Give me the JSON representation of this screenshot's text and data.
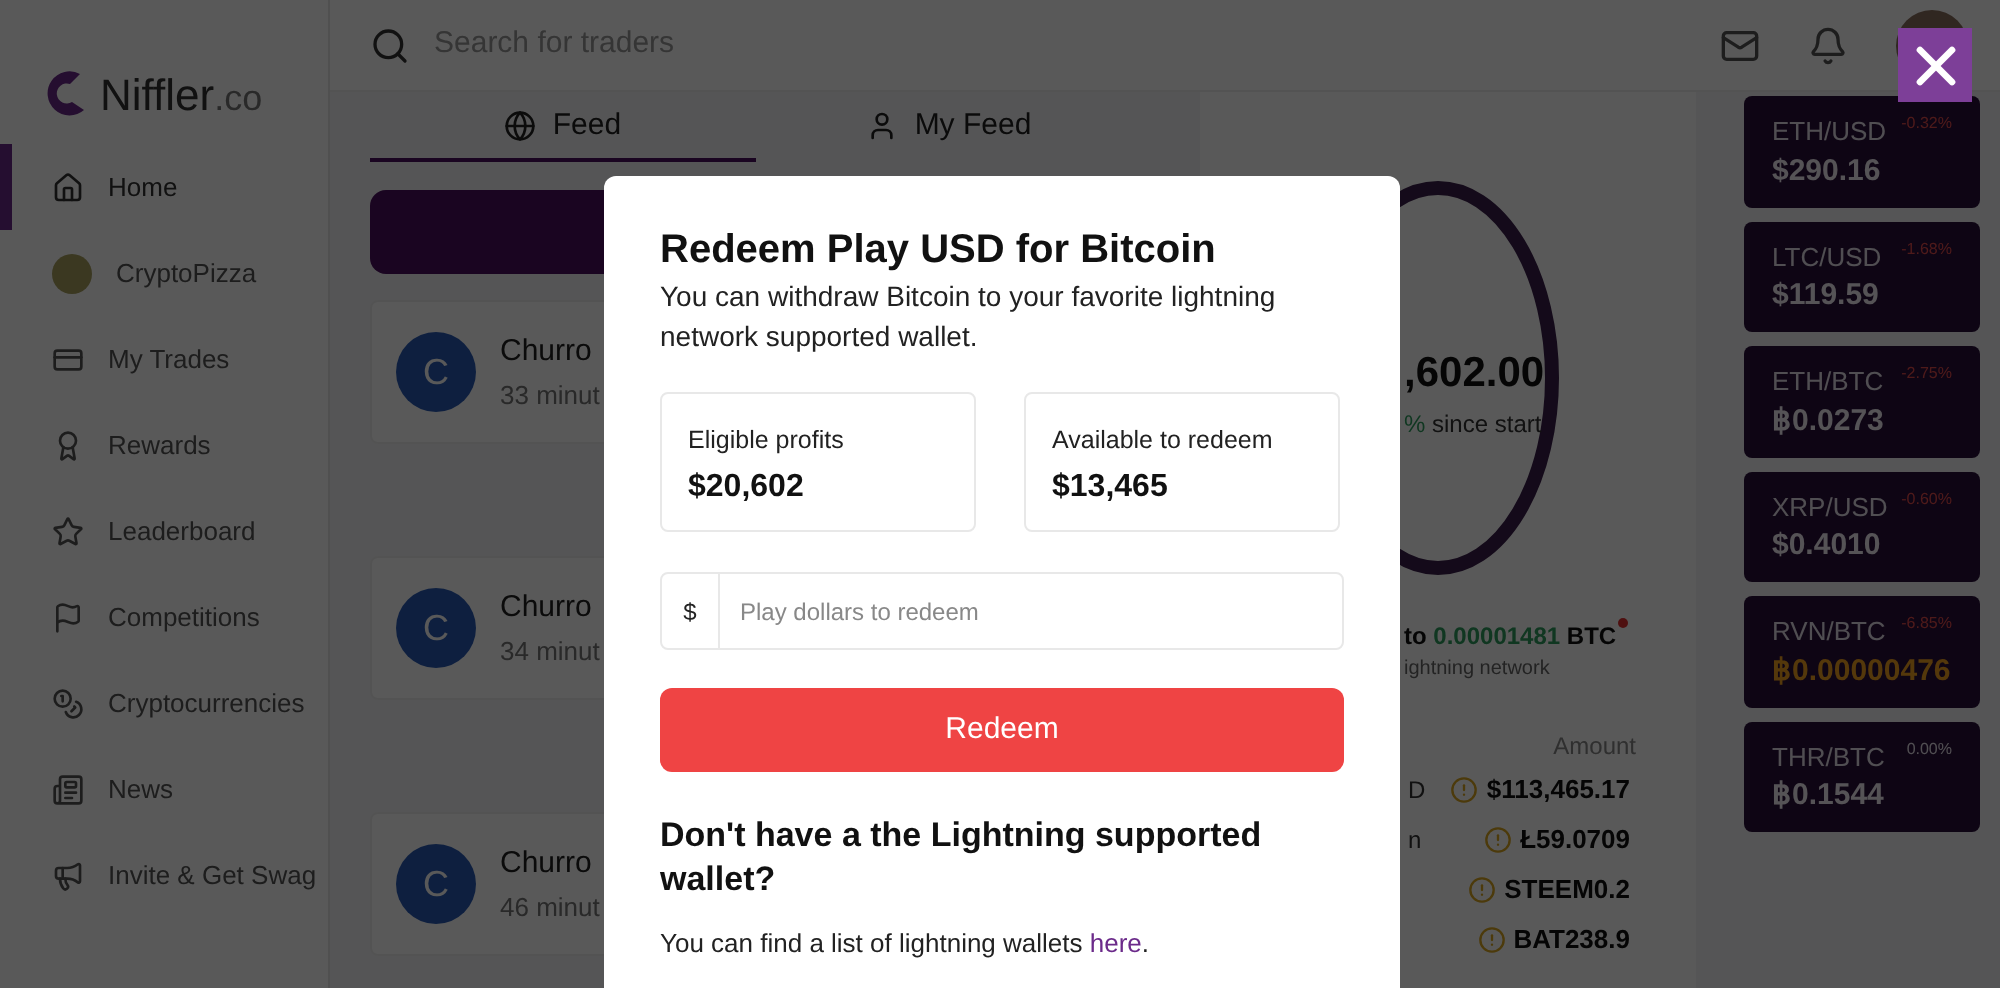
{
  "sidebar": {
    "logo": {
      "name": "Niffler",
      "suffix": ".co"
    },
    "items": [
      {
        "label": "Home",
        "selected": true
      },
      {
        "label": "CryptoPizza",
        "selected": false
      },
      {
        "label": "My Trades",
        "selected": false
      },
      {
        "label": "Rewards",
        "selected": false
      },
      {
        "label": "Leaderboard",
        "selected": false
      },
      {
        "label": "Competitions",
        "selected": false
      },
      {
        "label": "Cryptocurrencies",
        "selected": false
      },
      {
        "label": "News",
        "selected": false
      },
      {
        "label": "Invite & Get Swag",
        "selected": false
      }
    ]
  },
  "header": {
    "search": {
      "placeholder": "Search for traders"
    }
  },
  "feed": {
    "tabs": [
      {
        "label": "Feed",
        "selected": true
      },
      {
        "label": "My Feed",
        "selected": false
      }
    ],
    "posts": [
      {
        "initial": "C",
        "name": "Churro",
        "time": "33 minut"
      },
      {
        "initial": "C",
        "name": "Churro",
        "time": "34 minut"
      },
      {
        "initial": "C",
        "name": "Churro",
        "time": "46 minut"
      }
    ]
  },
  "portfolio": {
    "total": ",602.00",
    "change": "%",
    "change_label": "since start",
    "withdraw_prefix": "to",
    "withdraw_amount": "0.00001481",
    "withdraw_unit": "BTC",
    "withdraw_note": "ightning network",
    "amount_header": "Amount",
    "holdings": [
      {
        "label": "D",
        "amount": "$113,465.17"
      },
      {
        "label": "n",
        "amount": "Ł59.0709"
      },
      {
        "amount": "STEEM0.2"
      },
      {
        "amount": "BAT238.9"
      }
    ]
  },
  "tickers": [
    {
      "kind": "loss",
      "pair": "ETH/USD",
      "change": "-0.32%",
      "price": "$290.16"
    },
    {
      "kind": "loss",
      "pair": "LTC/USD",
      "change": "-1.68%",
      "price": "$119.59"
    },
    {
      "kind": "loss",
      "pair": "ETH/BTC",
      "change": "-2.75%",
      "price": "฿0.0273"
    },
    {
      "kind": "loss",
      "pair": "XRP/USD",
      "change": "-0.60%",
      "price": "$0.4010"
    },
    {
      "kind": "alert",
      "pair": "RVN/BTC",
      "change": "-6.85%",
      "price": "฿0.00000476"
    },
    {
      "kind": "flat",
      "pair": "THR/BTC",
      "change": "0.00%",
      "price": "฿0.1544"
    }
  ],
  "modal": {
    "title": "Redeem Play USD for Bitcoin",
    "subtitle": "You can withdraw Bitcoin to your favorite lightning network supported wallet.",
    "stats": [
      {
        "label": "Eligible profits",
        "value": "$20,602"
      },
      {
        "label": "Available to redeem",
        "value": "$13,465"
      }
    ],
    "input": {
      "prefix": "$",
      "placeholder": "Play dollars to redeem"
    },
    "button": "Redeem",
    "wallet_heading": "Don't have a the Lightning supported wallet?",
    "wallet_text": "You can find a list of lightning wallets",
    "wallet_link": "here",
    "wallet_end": "."
  }
}
